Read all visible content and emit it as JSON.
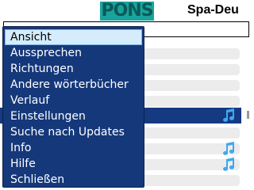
{
  "header": {
    "logo_text": "PONS",
    "dictionary_title": "Spa-Deu"
  },
  "search": {
    "value": ""
  },
  "menu": {
    "items": [
      {
        "label": "Ansicht",
        "selected": true
      },
      {
        "label": "Aussprechen"
      },
      {
        "label": "Richtungen"
      },
      {
        "label": "Andere wörterbücher"
      },
      {
        "label": "Verlauf"
      },
      {
        "label": "Einstellungen"
      },
      {
        "label": "Suche nach Updates"
      },
      {
        "label": "Info"
      },
      {
        "label": "Hilfe"
      },
      {
        "label": "Schließen"
      }
    ]
  },
  "colors": {
    "menu_background": "#15387a",
    "menu_selected_background": "#d4ecfb",
    "row_highlight": "#153a82",
    "logo_background": "#1aa39e",
    "note_icon": "#3fa8f0"
  },
  "icons": {
    "row_audio": "music-note-icon"
  }
}
